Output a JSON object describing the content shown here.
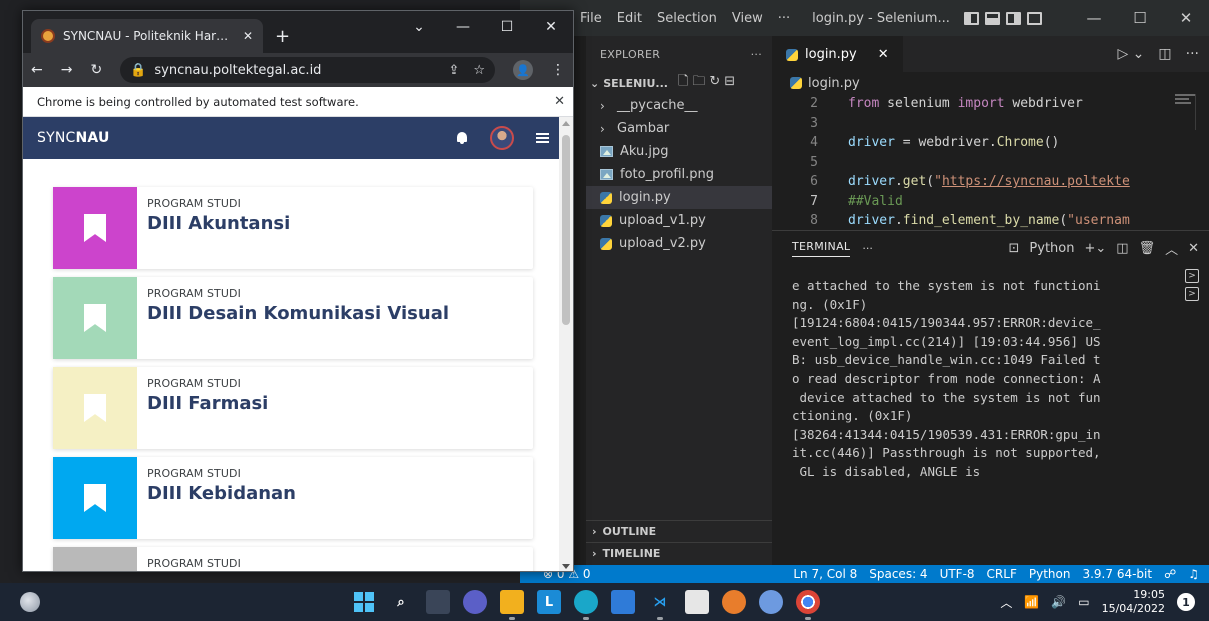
{
  "vscode": {
    "menu": [
      "File",
      "Edit",
      "Selection",
      "View",
      "···"
    ],
    "title": "login.py - Selenium...",
    "window_controls": [
      "—",
      "☐",
      "✕"
    ],
    "explorer": {
      "header": "EXPLORER",
      "header_more": "···",
      "section": "SELENIU...",
      "items": [
        {
          "label": "__pycache__",
          "kind": "folder"
        },
        {
          "label": "Gambar",
          "kind": "folder"
        },
        {
          "label": "Aku.jpg",
          "kind": "image"
        },
        {
          "label": "foto_profil.png",
          "kind": "image"
        },
        {
          "label": "login.py",
          "kind": "python",
          "active": true
        },
        {
          "label": "upload_v1.py",
          "kind": "python"
        },
        {
          "label": "upload_v2.py",
          "kind": "python"
        }
      ],
      "outline": "OUTLINE",
      "timeline": "TIMELINE"
    },
    "editor": {
      "tab_label": "login.py",
      "tab_close": "✕",
      "breadcrumb": "login.py",
      "lines": [
        {
          "num": "2",
          "tokens": [
            [
              "kw",
              "from"
            ],
            [
              "pl",
              " selenium "
            ],
            [
              "kw",
              "import"
            ],
            [
              "pl",
              " webdriver"
            ]
          ]
        },
        {
          "num": "3",
          "tokens": []
        },
        {
          "num": "4",
          "tokens": [
            [
              "id",
              "driver"
            ],
            [
              "pl",
              " = webdriver."
            ],
            [
              "fn",
              "Chrome"
            ],
            [
              "pl",
              "()"
            ]
          ]
        },
        {
          "num": "5",
          "tokens": []
        },
        {
          "num": "6",
          "tokens": [
            [
              "id",
              "driver"
            ],
            [
              "pl",
              "."
            ],
            [
              "fn",
              "get"
            ],
            [
              "pl",
              "("
            ],
            [
              "str",
              "\""
            ],
            [
              "url",
              "https://syncnau.poltekte"
            ]
          ]
        },
        {
          "num": "7",
          "tokens": [
            [
              "cm",
              "##Valid"
            ]
          ],
          "current": true
        },
        {
          "num": "8",
          "tokens": [
            [
              "id",
              "driver"
            ],
            [
              "pl",
              "."
            ],
            [
              "fn",
              "find_element_by_name"
            ],
            [
              "pl",
              "("
            ],
            [
              "str",
              "\"usernam"
            ]
          ]
        }
      ]
    },
    "terminal": {
      "title": "TERMINAL",
      "more": "···",
      "shell": "Python",
      "text": "e attached to the system is not functioni\nng. (0x1F)\n[19124:6804:0415/190344.957:ERROR:device_\nevent_log_impl.cc(214)] [19:03:44.956] US\nB: usb_device_handle_win.cc:1049 Failed t\no read descriptor from node connection: A\n device attached to the system is not fun\nctioning. (0x1F)\n[38264:41344:0415/190539.431:ERROR:gpu_in\nit.cc(446)] Passthrough is not supported,\n GL is disabled, ANGLE is"
    },
    "status": {
      "problems": "⊗ 0 ⚠ 0",
      "position": "Ln 7, Col 8",
      "spaces": "Spaces: 4",
      "encoding": "UTF-8",
      "eol": "CRLF",
      "language": "Python",
      "interpreter": "3.9.7 64-bit"
    }
  },
  "chrome": {
    "tab_title": "SYNCNAU - Politeknik Harapan B",
    "tab_close": "✕",
    "new_tab": "+",
    "window_controls": [
      "⌄",
      "—",
      "☐",
      "✕"
    ],
    "url": "syncnau.poltektegal.ac.id",
    "infobar": "Chrome is being controlled by automated test software.",
    "infobar_close": "✕"
  },
  "app": {
    "brand_prefix": "SYNC",
    "brand_bold": "NAU",
    "cards": [
      {
        "label": "PROGRAM STUDI",
        "title": "DIII Akuntansi",
        "color": "#cc44cc"
      },
      {
        "label": "PROGRAM STUDI",
        "title": "DIII Desain Komunikasi Visual",
        "color": "#a3d9b8"
      },
      {
        "label": "PROGRAM STUDI",
        "title": "DIII Farmasi",
        "color": "#f5f0c4"
      },
      {
        "label": "PROGRAM STUDI",
        "title": "DIII Kebidanan",
        "color": "#00a8f0"
      },
      {
        "label": "PROGRAM STUDI",
        "title": "",
        "color": "#b9b9b9"
      }
    ]
  },
  "taskbar": {
    "apps": [
      "start",
      "search",
      "task-view",
      "meet",
      "file-explorer",
      "L",
      "edge",
      "store",
      "vscode",
      "app-b",
      "app-c",
      "app-d",
      "chrome"
    ],
    "time": "19:05",
    "date": "15/04/2022",
    "notifications": "1"
  }
}
